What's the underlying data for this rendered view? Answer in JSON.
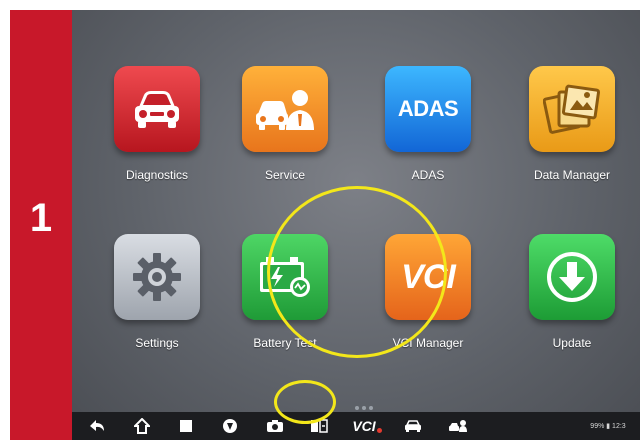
{
  "step": {
    "number": "1"
  },
  "apps": [
    {
      "label": "Diagnostics",
      "icon": "car-icon"
    },
    {
      "label": "Service",
      "icon": "car-mechanic-icon"
    },
    {
      "label": "ADAS",
      "icon": "adas-icon",
      "icon_text": "ADAS"
    },
    {
      "label": "Data Manager",
      "icon": "photo-folder-icon"
    },
    {
      "label": "Settings",
      "icon": "gear-icon"
    },
    {
      "label": "Battery Test",
      "icon": "battery-icon"
    },
    {
      "label": "VCI Manager",
      "icon": "vci-icon",
      "icon_text": "VCI"
    },
    {
      "label": "Update",
      "icon": "download-arrow-icon"
    }
  ],
  "taskbar": {
    "icons": [
      "back-icon",
      "home-icon",
      "recent-apps-icon",
      "browser-icon",
      "camera-icon",
      "screen-mirror-icon",
      "vci-status-icon",
      "car-icon",
      "mechanic-icon"
    ],
    "vci_label": "VCI",
    "status_text": "99% ▮ 12:3"
  },
  "colors": {
    "step_panel": "#c8182a",
    "highlight": "#f3e71a",
    "taskbar": "#1c1d20"
  }
}
